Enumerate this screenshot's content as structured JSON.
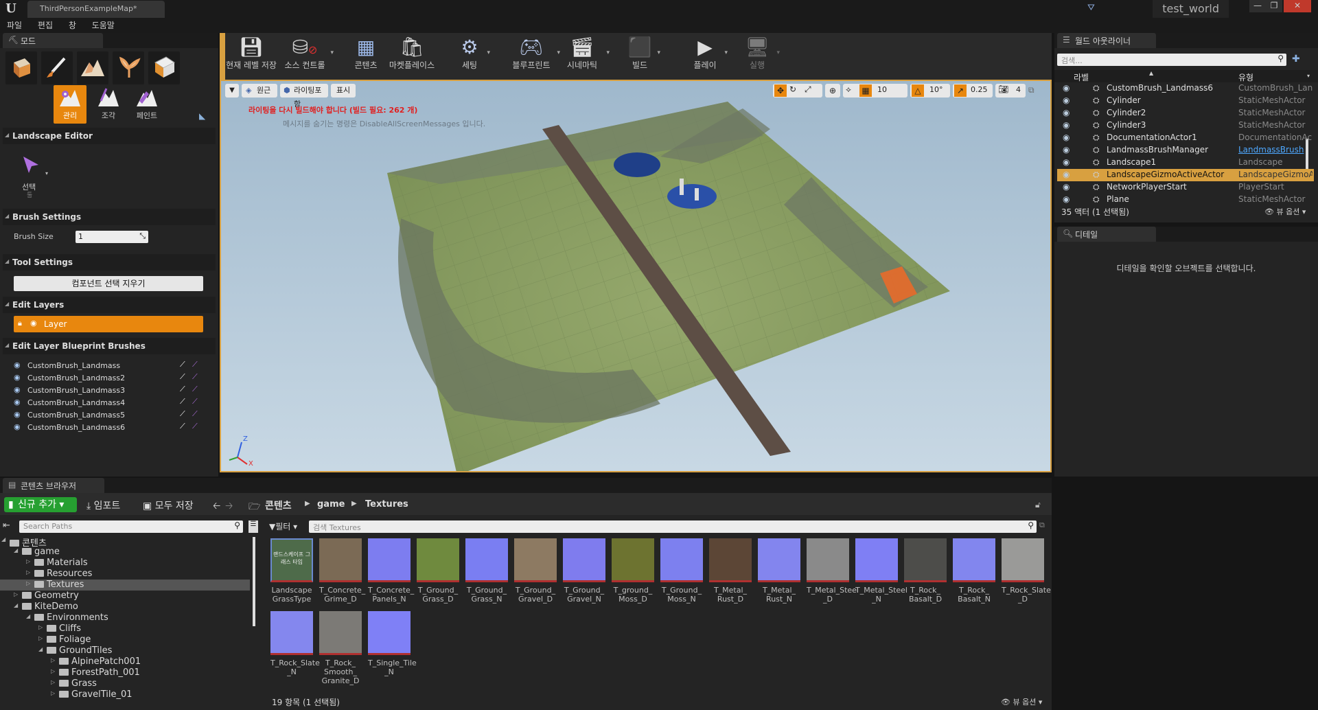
{
  "window": {
    "doc_tab": "ThirdPersonExampleMap*",
    "project": "test_world",
    "minimize": "—",
    "maximize": "❐",
    "close": "✕"
  },
  "menu": [
    "파일",
    "편집",
    "창",
    "도움말"
  ],
  "modes_panel": {
    "tab": "모드",
    "subtools": [
      "관리",
      "조각",
      "페인트"
    ],
    "landscape_editor": "Landscape Editor",
    "select_tool": "선택",
    "select_sub": "툴",
    "brush_settings": "Brush Settings",
    "brush_size_label": "Brush Size",
    "brush_size_value": "1",
    "tool_settings": "Tool Settings",
    "clear_button": "컴포넌트 선택 지우기",
    "edit_layers": "Edit Layers",
    "layer_name": "Layer",
    "blueprint_brushes": "Edit Layer Blueprint Brushes",
    "brushes": [
      "CustomBrush_Landmass",
      "CustomBrush_Landmass2",
      "CustomBrush_Landmass3",
      "CustomBrush_Landmass4",
      "CustomBrush_Landmass5",
      "CustomBrush_Landmass6"
    ]
  },
  "toolbar": [
    {
      "label": "현재 레벨 저장",
      "icon": "save-icon"
    },
    {
      "label": "소스 컨트롤",
      "icon": "source-control-icon"
    },
    {
      "label": "콘텐츠",
      "icon": "content-icon"
    },
    {
      "label": "마켓플레이스",
      "icon": "marketplace-icon"
    },
    {
      "label": "세팅",
      "icon": "settings-icon"
    },
    {
      "label": "블루프린트",
      "icon": "blueprint-icon"
    },
    {
      "label": "시네마틱",
      "icon": "cinematics-icon"
    },
    {
      "label": "빌드",
      "icon": "build-icon"
    },
    {
      "label": "플레이",
      "icon": "play-icon"
    },
    {
      "label": "실행",
      "icon": "launch-icon"
    }
  ],
  "viewport": {
    "perspective": "원근",
    "lit": "라이팅포함",
    "show": "표시",
    "warning": "라이팅을 다시 빌드해야 합니다 (빌드 필요: 262 개)",
    "hint": "메시지를 숨기는 명령은 DisableAllScreenMessages 입니다.",
    "grid_snap": "10",
    "rot_snap": "10°",
    "scale_snap": "0.25",
    "cam_speed": "4",
    "axis_z": "Z",
    "axis_x": "X"
  },
  "outliner": {
    "tab": "월드 아웃라이너",
    "search_placeholder": "검색...",
    "col_label": "라벨",
    "col_type": "유형",
    "rows": [
      {
        "name": "CustomBrush_Landmass6",
        "type": "CustomBrush_Lan",
        "sel": false
      },
      {
        "name": "Cylinder",
        "type": "StaticMeshActor",
        "sel": false
      },
      {
        "name": "Cylinder2",
        "type": "StaticMeshActor",
        "sel": false
      },
      {
        "name": "Cylinder3",
        "type": "StaticMeshActor",
        "sel": false
      },
      {
        "name": "DocumentationActor1",
        "type": "DocumentationAc",
        "sel": false
      },
      {
        "name": "LandmassBrushManager",
        "type": "LandmassBrush",
        "sel": false
      },
      {
        "name": "Landscape1",
        "type": "Landscape",
        "sel": false
      },
      {
        "name": "LandscapeGizmoActiveActor",
        "type": "LandscapeGizmoA",
        "sel": true
      },
      {
        "name": "NetworkPlayerStart",
        "type": "PlayerStart",
        "sel": false
      },
      {
        "name": "Plane",
        "type": "StaticMeshActor",
        "sel": false
      }
    ],
    "count": "35 액터 (1 선택됨)",
    "view_options": "뷰 옵션"
  },
  "details": {
    "tab": "디테일",
    "empty_msg": "디테일을 확인할 오브젝트를 선택합니다."
  },
  "content_browser": {
    "tab": "콘텐츠 브라우저",
    "add_new": "신규 추가",
    "import": "임포트",
    "save_all": "모두 저장",
    "path": [
      "콘텐츠",
      "game",
      "Textures"
    ],
    "search_paths": "Search Paths",
    "filter": "필터",
    "search_textures": "검색 Textures",
    "tree": [
      {
        "label": "콘텐츠",
        "depth": 0,
        "expanded": true
      },
      {
        "label": "game",
        "depth": 1,
        "expanded": true
      },
      {
        "label": "Materials",
        "depth": 2
      },
      {
        "label": "Resources",
        "depth": 2
      },
      {
        "label": "Textures",
        "depth": 2,
        "selected": true
      },
      {
        "label": "Geometry",
        "depth": 1
      },
      {
        "label": "KiteDemo",
        "depth": 1,
        "expanded": true
      },
      {
        "label": "Environments",
        "depth": 2,
        "expanded": true
      },
      {
        "label": "Cliffs",
        "depth": 3
      },
      {
        "label": "Foliage",
        "depth": 3
      },
      {
        "label": "GroundTiles",
        "depth": 3,
        "expanded": true
      },
      {
        "label": "AlpinePatch001",
        "depth": 4
      },
      {
        "label": "ForestPath_001",
        "depth": 4
      },
      {
        "label": "Grass",
        "depth": 4
      },
      {
        "label": "GravelTile_01",
        "depth": 4
      }
    ],
    "assets": [
      {
        "name": "Landscape GrassType",
        "color": "#4e6b4a",
        "thumb_text": "랜드스케이프 그래스 타입",
        "selected": true
      },
      {
        "name": "T_Concrete_ Grime_D",
        "color": "#7b6a55"
      },
      {
        "name": "T_Concrete_ Panels_N",
        "color": "#7d7df0"
      },
      {
        "name": "T_Ground_ Grass_D",
        "color": "#6f8a3e"
      },
      {
        "name": "T_Ground_ Grass_N",
        "color": "#7a7ef2"
      },
      {
        "name": "T_Ground_ Gravel_D",
        "color": "#8d7a62"
      },
      {
        "name": "T_Ground_ Gravel_N",
        "color": "#7f7cee"
      },
      {
        "name": "T_ground_ Moss_D",
        "color": "#6d7330"
      },
      {
        "name": "T_Ground_ Moss_N",
        "color": "#7d80ef"
      },
      {
        "name": "T_Metal_ Rust_D",
        "color": "#5c4636"
      },
      {
        "name": "T_Metal_ Rust_N",
        "color": "#8385ee"
      },
      {
        "name": "T_Metal_Steel _D",
        "color": "#8a8a8a"
      },
      {
        "name": "T_Metal_Steel _N",
        "color": "#7f7ff4"
      },
      {
        "name": "T_Rock_ Basalt_D",
        "color": "#4d4d4a"
      },
      {
        "name": "T_Rock_ Basalt_N",
        "color": "#8286ee"
      },
      {
        "name": "T_Rock_Slate _D",
        "color": "#9a9a98"
      },
      {
        "name": "T_Rock_Slate _N",
        "color": "#8487ee"
      },
      {
        "name": "T_Rock_ Smooth_ Granite_D",
        "color": "#7c7a76"
      },
      {
        "name": "T_Single_Tile _N",
        "color": "#7f80f6"
      }
    ],
    "count": "19 항목 (1 선택됨)",
    "view_options": "뷰 옵션"
  },
  "colors": {
    "accent": "#e8870e",
    "selection": "#d8a040",
    "link": "#4ea8ff",
    "warning": "#e02020"
  }
}
